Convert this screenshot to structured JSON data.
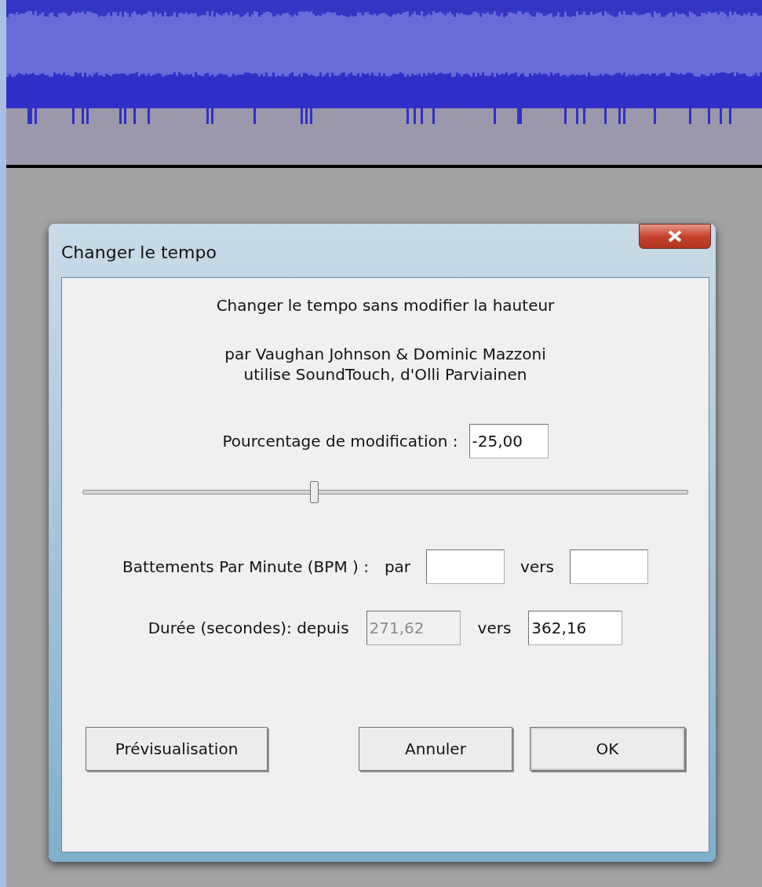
{
  "dialog": {
    "title": "Changer le tempo",
    "heading": "Changer le tempo sans modifier la hauteur",
    "credits": [
      "par Vaughan Johnson & Dominic Mazzoni",
      "utilise SoundTouch, d'Olli Parviainen"
    ],
    "percent": {
      "label": "Pourcentage de modification :",
      "value": "-25,00"
    },
    "slider": {
      "level": 0.38
    },
    "bpm": {
      "label": "Battements Par Minute (BPM ) :",
      "fields": [
        {
          "label": "par",
          "disabled": false
        },
        {
          "label": "vers",
          "disabled": false
        }
      ]
    },
    "duration": {
      "label": "Durée (secondes): depuis",
      "fields": [
        {
          "value": "271,62",
          "disabled": true
        },
        {
          "label": "vers",
          "value": "362,16",
          "disabled": false
        }
      ]
    },
    "buttons": [
      {
        "label": "Prévisualisation",
        "default": false
      },
      {
        "label": "Annuler",
        "default": false
      },
      {
        "label": "OK",
        "default": true
      }
    ]
  }
}
